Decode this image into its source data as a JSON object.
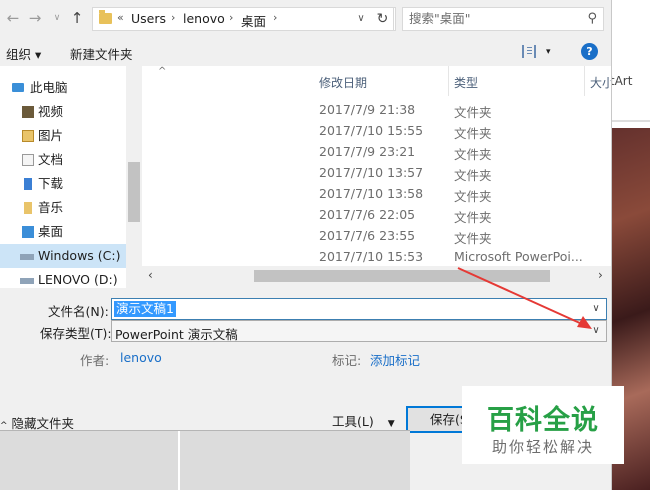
{
  "colors": {
    "accent": "#0078d7",
    "selection": "#3399ff",
    "arrow": "#e53935",
    "watermark_green": "#27a046"
  },
  "nav": {
    "back_icon": "back-arrow-icon",
    "forward_icon": "forward-arrow-icon",
    "up_icon": "up-arrow-icon",
    "breadcrumb": [
      "Users",
      "lenovo",
      "桌面"
    ],
    "search_placeholder": "搜索\"桌面\""
  },
  "toolbar": {
    "organize": "组织 ▾",
    "new_folder": "新建文件夹"
  },
  "sidebar": {
    "items": [
      {
        "label": "此电脑",
        "icon": "computer-icon"
      },
      {
        "label": "视频",
        "icon": "video-folder-icon"
      },
      {
        "label": "图片",
        "icon": "pictures-folder-icon"
      },
      {
        "label": "文档",
        "icon": "documents-folder-icon"
      },
      {
        "label": "下载",
        "icon": "downloads-folder-icon"
      },
      {
        "label": "音乐",
        "icon": "music-folder-icon"
      },
      {
        "label": "桌面",
        "icon": "desktop-folder-icon"
      },
      {
        "label": "Windows (C:)",
        "icon": "drive-icon"
      },
      {
        "label": "LENOVO (D:)",
        "icon": "drive-icon"
      }
    ]
  },
  "file_list": {
    "columns": [
      "修改日期",
      "类型",
      "大小"
    ],
    "rows": [
      {
        "date": "2017/7/9 21:38",
        "type": "文件夹"
      },
      {
        "date": "2017/7/10 15:55",
        "type": "文件夹"
      },
      {
        "date": "2017/7/9 23:21",
        "type": "文件夹"
      },
      {
        "date": "2017/7/10 13:57",
        "type": "文件夹"
      },
      {
        "date": "2017/7/10 13:58",
        "type": "文件夹"
      },
      {
        "date": "2017/7/6 22:05",
        "type": "文件夹"
      },
      {
        "date": "2017/7/6 23:55",
        "type": "文件夹"
      },
      {
        "date": "2017/7/10 15:53",
        "type": "Microsoft PowerPoi..."
      }
    ]
  },
  "form": {
    "filename_label": "文件名(N):",
    "filename_value": "演示文稿1",
    "filetype_label": "保存类型(T):",
    "filetype_value": "PowerPoint 演示文稿",
    "author_label": "作者:",
    "author_value": "lenovo",
    "tags_label": "标记:",
    "tags_value": "添加标记",
    "hide_folders": "隐藏文件夹",
    "tools": "工具(L)",
    "save": "保存(S"
  },
  "background": {
    "partial_title": "nartArt"
  },
  "watermark": {
    "title": "百科全说",
    "subtitle": "助你轻松解决"
  }
}
